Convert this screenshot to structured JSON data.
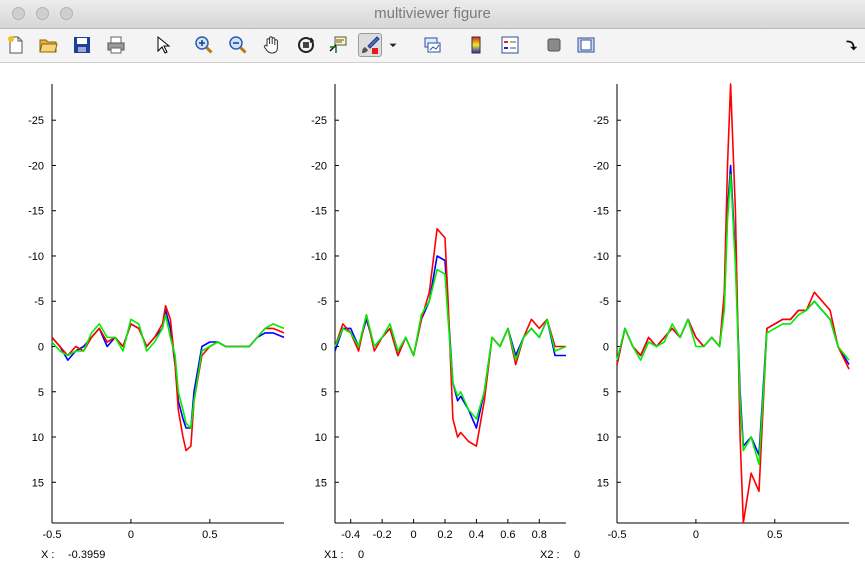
{
  "window": {
    "title": "multiviewer figure"
  },
  "toolbar": {
    "tools": [
      {
        "name": "new-figure-icon"
      },
      {
        "name": "open-file-icon"
      },
      {
        "name": "save-icon"
      },
      {
        "name": "print-icon"
      },
      {
        "name": "pointer-icon"
      },
      {
        "name": "zoom-in-icon"
      },
      {
        "name": "zoom-out-icon"
      },
      {
        "name": "pan-hand-icon"
      },
      {
        "name": "rotate-3d-icon"
      },
      {
        "name": "data-cursor-icon"
      },
      {
        "name": "brush-icon"
      },
      {
        "name": "dropdown-arrow-icon"
      },
      {
        "name": "link-plot-icon"
      },
      {
        "name": "colorbar-icon"
      },
      {
        "name": "legend-icon"
      },
      {
        "name": "hide-plot-tools-icon"
      },
      {
        "name": "show-plot-tools-icon"
      },
      {
        "name": "dock-arrow-icon"
      }
    ]
  },
  "colors": {
    "series1": "#0000ff",
    "series2": "#ff0000",
    "series3": "#00ee00"
  },
  "readouts": {
    "x_label": "X :",
    "x_value": "-0.3959",
    "x1_label": "X1 :",
    "x1_value": "0",
    "x2_label": "X2 :",
    "x2_value": "0"
  },
  "chart_data": [
    {
      "type": "line",
      "y_reversed": true,
      "xlim": [
        -0.5,
        0.97
      ],
      "ylim": [
        19.5,
        -29
      ],
      "xticks": [
        "-0.5",
        "0",
        "0.5"
      ],
      "xtick_values": [
        -0.5,
        0,
        0.5
      ],
      "yticks": [
        "-25",
        "-20",
        "-15",
        "-10",
        "-5",
        "0",
        "5",
        "10",
        "15"
      ],
      "ytick_values": [
        -25,
        -20,
        -15,
        -10,
        -5,
        0,
        5,
        10,
        15
      ],
      "x": [
        -0.5,
        -0.45,
        -0.4,
        -0.35,
        -0.3,
        -0.25,
        -0.2,
        -0.15,
        -0.1,
        -0.05,
        0,
        0.05,
        0.1,
        0.15,
        0.2,
        0.22,
        0.25,
        0.28,
        0.3,
        0.33,
        0.35,
        0.38,
        0.4,
        0.45,
        0.5,
        0.55,
        0.6,
        0.65,
        0.7,
        0.75,
        0.8,
        0.85,
        0.9,
        0.97
      ],
      "series": [
        {
          "color": "#0000ff",
          "values": [
            -1,
            0,
            1.5,
            0.5,
            0,
            -1,
            -2,
            0,
            -1,
            0,
            -2.5,
            -2,
            0,
            -1,
            -2,
            -4,
            -2,
            2,
            6,
            8,
            9,
            9,
            5,
            0,
            -0.5,
            -0.5,
            0,
            0,
            0,
            0,
            -1,
            -1.5,
            -1.5,
            -1
          ]
        },
        {
          "color": "#ff0000",
          "values": [
            -1,
            0,
            1,
            0,
            0.5,
            -1,
            -2,
            -0.5,
            -1,
            0,
            -2.5,
            -2,
            0,
            -1,
            -2.5,
            -4.5,
            -3,
            2,
            7,
            10,
            11.5,
            11,
            6,
            1,
            0,
            -0.5,
            0,
            0,
            0,
            0,
            -1,
            -2,
            -2,
            -1.5
          ]
        },
        {
          "color": "#00ee00",
          "values": [
            -0.5,
            0.5,
            1,
            0.5,
            0.5,
            -1.5,
            -2.5,
            -1,
            -1,
            0.5,
            -3,
            -2.5,
            0.5,
            -0.5,
            -2,
            -3.5,
            -1,
            1,
            5,
            7,
            8.5,
            9,
            6,
            0.5,
            0,
            -0.5,
            0,
            0,
            0,
            0,
            -1,
            -2,
            -2.5,
            -2
          ]
        }
      ]
    },
    {
      "type": "line",
      "y_reversed": true,
      "xlim": [
        -0.5,
        0.97
      ],
      "ylim": [
        19.5,
        -29
      ],
      "xticks": [
        "-0.4",
        "-0.2",
        "0",
        "0.2",
        "0.4",
        "0.6",
        "0.8"
      ],
      "xtick_values": [
        -0.4,
        -0.2,
        0,
        0.2,
        0.4,
        0.6,
        0.8
      ],
      "yticks": [
        "-25",
        "-20",
        "-15",
        "-10",
        "-5",
        "0",
        "5",
        "10",
        "15"
      ],
      "ytick_values": [
        -25,
        -20,
        -15,
        -10,
        -5,
        0,
        5,
        10,
        15
      ],
      "x": [
        -0.5,
        -0.45,
        -0.4,
        -0.35,
        -0.3,
        -0.25,
        -0.2,
        -0.15,
        -0.1,
        -0.05,
        0,
        0.05,
        0.1,
        0.15,
        0.2,
        0.22,
        0.25,
        0.28,
        0.3,
        0.35,
        0.4,
        0.45,
        0.5,
        0.55,
        0.6,
        0.65,
        0.7,
        0.75,
        0.8,
        0.85,
        0.9,
        0.97
      ],
      "series": [
        {
          "color": "#0000ff",
          "values": [
            0.5,
            -2,
            -2,
            0,
            -3,
            0,
            -1,
            -2,
            1,
            -1,
            1,
            -3,
            -5,
            -10,
            -9.5,
            -4,
            4,
            6,
            5.5,
            7,
            9,
            5,
            -1,
            0,
            -2,
            1,
            -1,
            -2,
            -1,
            -3,
            1,
            1
          ]
        },
        {
          "color": "#ff0000",
          "values": [
            0,
            -2.5,
            -1.5,
            0.5,
            -3.5,
            0.5,
            -1,
            -2,
            1,
            -1,
            1,
            -3,
            -6,
            -13,
            -12,
            -5,
            8,
            10,
            9.5,
            10.5,
            11,
            6,
            -1,
            0,
            -2,
            2,
            -1,
            -3,
            -2,
            -3,
            0,
            0
          ]
        },
        {
          "color": "#00ee00",
          "values": [
            0,
            -2,
            -1.5,
            0,
            -3.5,
            0,
            -1,
            -2.5,
            0.5,
            -1,
            1,
            -3.5,
            -5,
            -8.5,
            -8,
            -3,
            4,
            5.5,
            5,
            7,
            8,
            5,
            -1,
            0,
            -2,
            1.5,
            -1,
            -2,
            -1,
            -3,
            0.5,
            0
          ]
        }
      ]
    },
    {
      "type": "line",
      "y_reversed": true,
      "xlim": [
        -0.5,
        0.97
      ],
      "ylim": [
        19.5,
        -29
      ],
      "xticks": [
        "-0.5",
        "0",
        "0.5"
      ],
      "xtick_values": [
        -0.5,
        0,
        0.5
      ],
      "yticks": [
        "-25",
        "-20",
        "-15",
        "-10",
        "-5",
        "0",
        "5",
        "10",
        "15"
      ],
      "ytick_values": [
        -25,
        -20,
        -15,
        -10,
        -5,
        0,
        5,
        10,
        15
      ],
      "x": [
        -0.5,
        -0.45,
        -0.4,
        -0.35,
        -0.3,
        -0.25,
        -0.2,
        -0.15,
        -0.1,
        -0.05,
        0,
        0.05,
        0.1,
        0.15,
        0.18,
        0.2,
        0.22,
        0.25,
        0.28,
        0.3,
        0.35,
        0.4,
        0.45,
        0.5,
        0.55,
        0.6,
        0.65,
        0.7,
        0.75,
        0.8,
        0.85,
        0.9,
        0.97
      ],
      "series": [
        {
          "color": "#0000ff",
          "values": [
            2,
            -2,
            0,
            1,
            -1,
            0,
            -1,
            -2,
            -1,
            -3,
            -1,
            0,
            -1,
            0,
            -5,
            -15,
            -20,
            -10,
            5,
            11,
            10,
            12,
            -2,
            -2.5,
            -3,
            -3,
            -4,
            -4,
            -5,
            -4,
            -3,
            0,
            2
          ]
        },
        {
          "color": "#ff0000",
          "values": [
            2,
            -2,
            0,
            1,
            -1,
            0,
            -1,
            -2,
            -1,
            -3,
            -1,
            0,
            -1,
            0,
            -6,
            -20,
            -29,
            -15,
            10,
            19.5,
            14,
            16,
            -2,
            -2.5,
            -3,
            -3,
            -4,
            -4,
            -6,
            -5,
            -4,
            0,
            2.5
          ]
        },
        {
          "color": "#00ee00",
          "values": [
            1.5,
            -2,
            0,
            1.5,
            -0.5,
            0,
            -0.5,
            -2.5,
            -1,
            -3,
            0,
            0,
            -1,
            0,
            -4,
            -14,
            -19,
            -9,
            6,
            11.5,
            10,
            13,
            -1.5,
            -2,
            -2.5,
            -2.5,
            -3.5,
            -4,
            -5,
            -4,
            -3,
            0,
            1.5
          ]
        }
      ]
    }
  ]
}
